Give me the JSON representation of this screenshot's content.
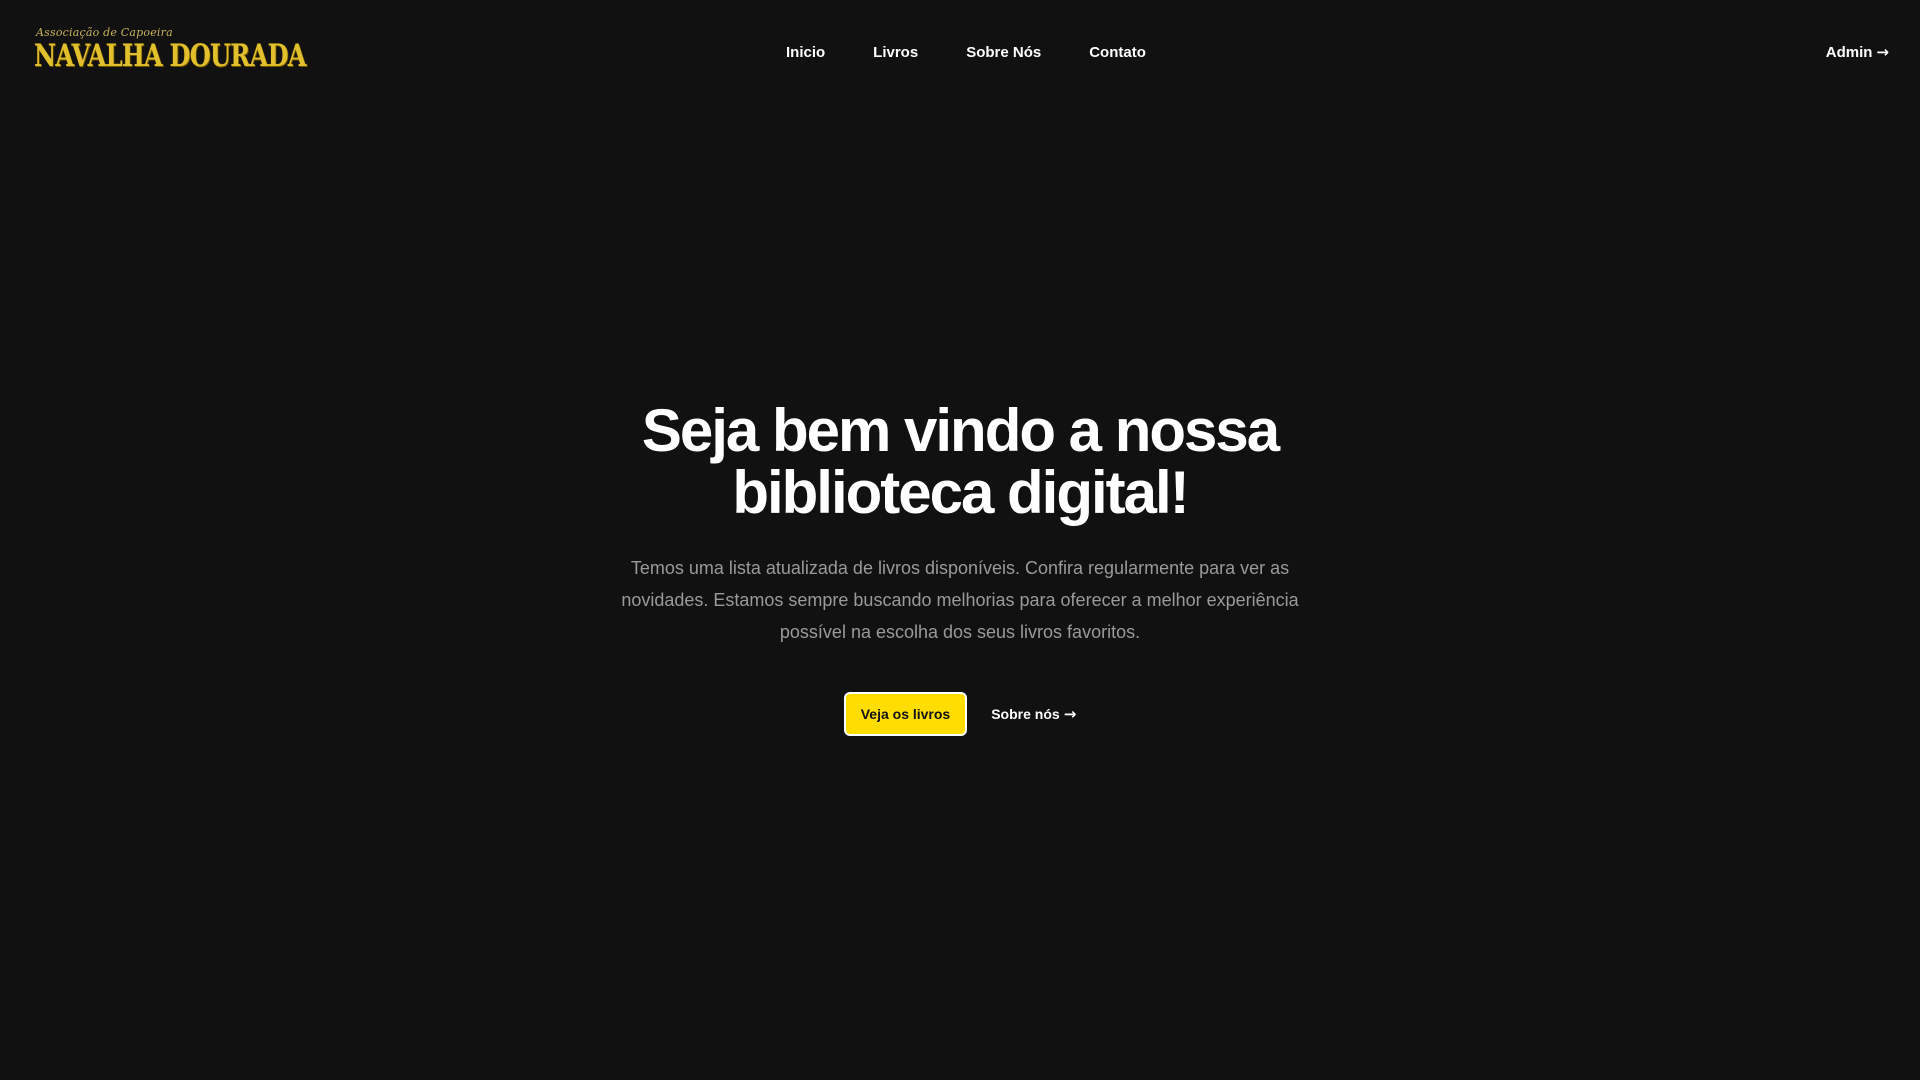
{
  "header": {
    "logo": {
      "subtitle": "Associação de Capoeira",
      "title": "NAVALHA DOURADA"
    },
    "nav": [
      {
        "label": "Inicio"
      },
      {
        "label": "Livros"
      },
      {
        "label": "Sobre Nós"
      },
      {
        "label": "Contato"
      }
    ],
    "admin_label": "Admin",
    "arrow_icon": "→"
  },
  "hero": {
    "title": "Seja bem vindo a nossa biblioteca digital!",
    "description": "Temos uma lista atualizada de livros disponíveis. Confira regularmente para ver as novidades. Estamos sempre buscando melhorias para oferecer a melhor experiência possível na escolha dos seus livros favoritos.",
    "primary_button": "Veja os livros",
    "secondary_link": "Sobre nós",
    "arrow_icon": "→"
  },
  "colors": {
    "background": "#111111",
    "accent": "#ffdd00",
    "logo_gold": "#e2bf2c",
    "text_muted": "#9a9a9a"
  }
}
